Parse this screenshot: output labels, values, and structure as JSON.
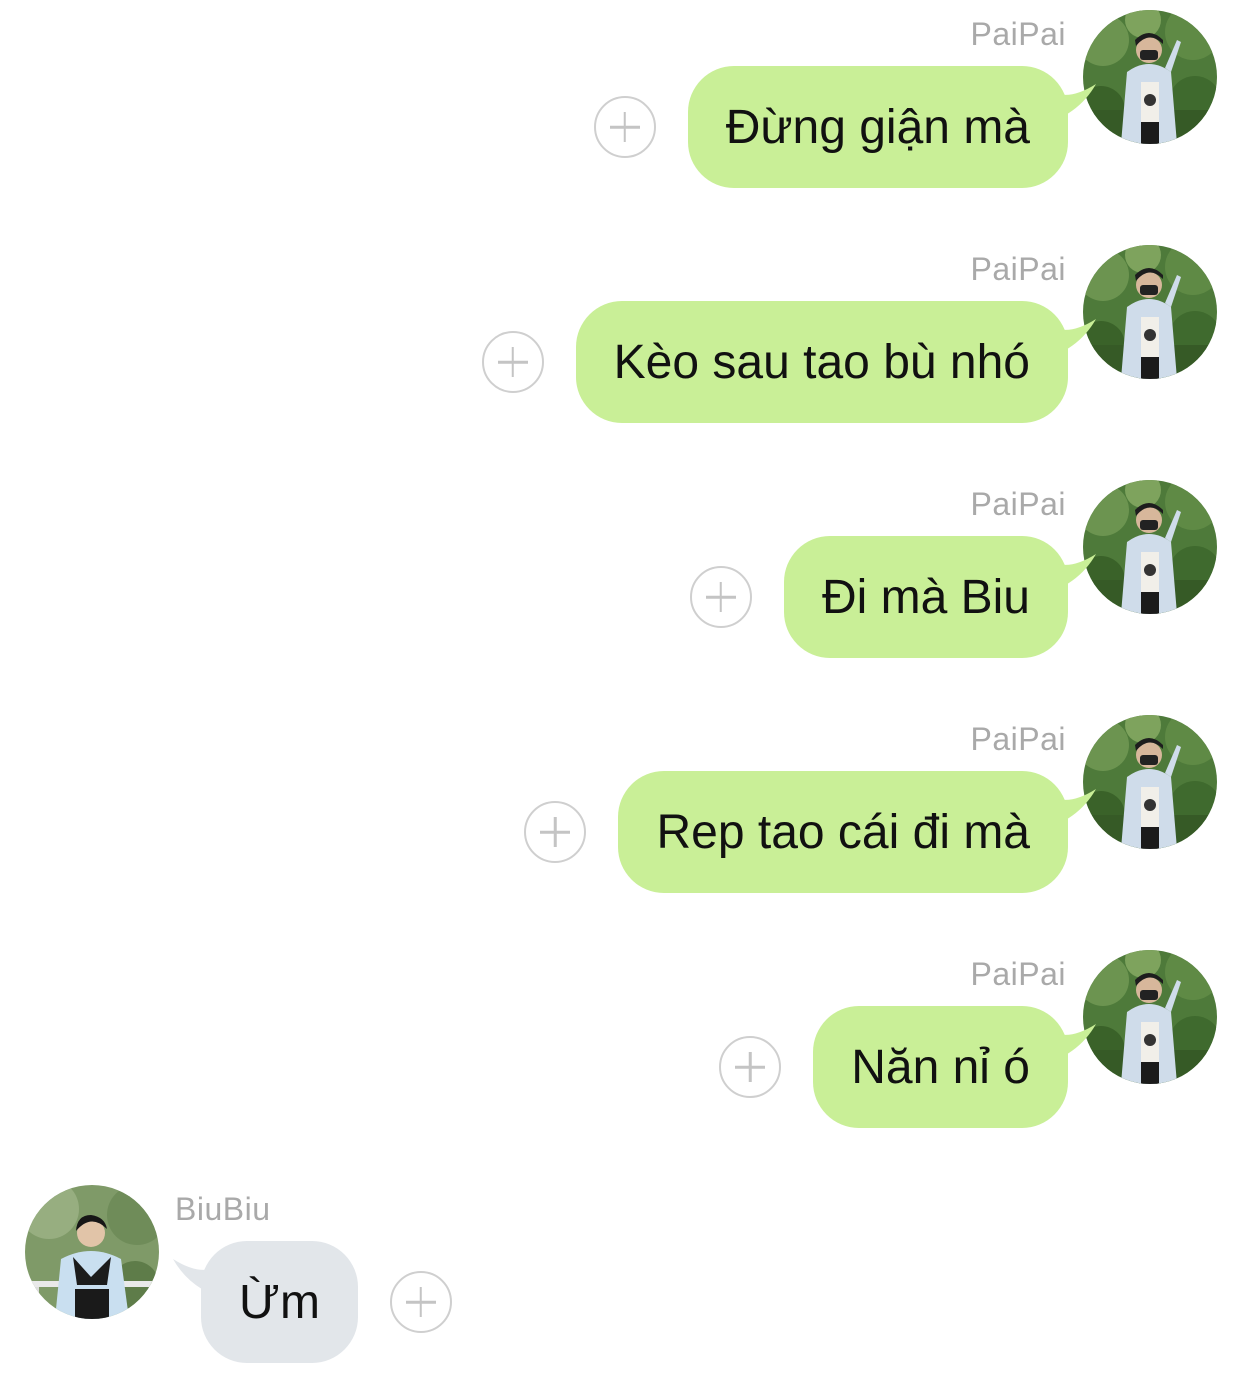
{
  "colors": {
    "outgoing_bubble": "#c9ef97",
    "incoming_bubble": "#e2e6ea",
    "name_text": "#a9a9a9"
  },
  "messages": [
    {
      "sender": "PaiPai",
      "side": "right",
      "text": "Đừng giận mà",
      "avatar_icon": "paipai-avatar",
      "reaction_icon": "add-reaction-icon"
    },
    {
      "sender": "PaiPai",
      "side": "right",
      "text": "Kèo sau tao bù nhó",
      "avatar_icon": "paipai-avatar",
      "reaction_icon": "add-reaction-icon"
    },
    {
      "sender": "PaiPai",
      "side": "right",
      "text": "Đi mà Biu",
      "avatar_icon": "paipai-avatar",
      "reaction_icon": "add-reaction-icon"
    },
    {
      "sender": "PaiPai",
      "side": "right",
      "text": "Rep tao cái đi mà",
      "avatar_icon": "paipai-avatar",
      "reaction_icon": "add-reaction-icon"
    },
    {
      "sender": "PaiPai",
      "side": "right",
      "text": "Năn nỉ ó",
      "avatar_icon": "paipai-avatar",
      "reaction_icon": "add-reaction-icon"
    },
    {
      "sender": "BiuBiu",
      "side": "left",
      "text": "Ừm",
      "avatar_icon": "biubiu-avatar",
      "reaction_icon": "add-reaction-icon"
    }
  ]
}
